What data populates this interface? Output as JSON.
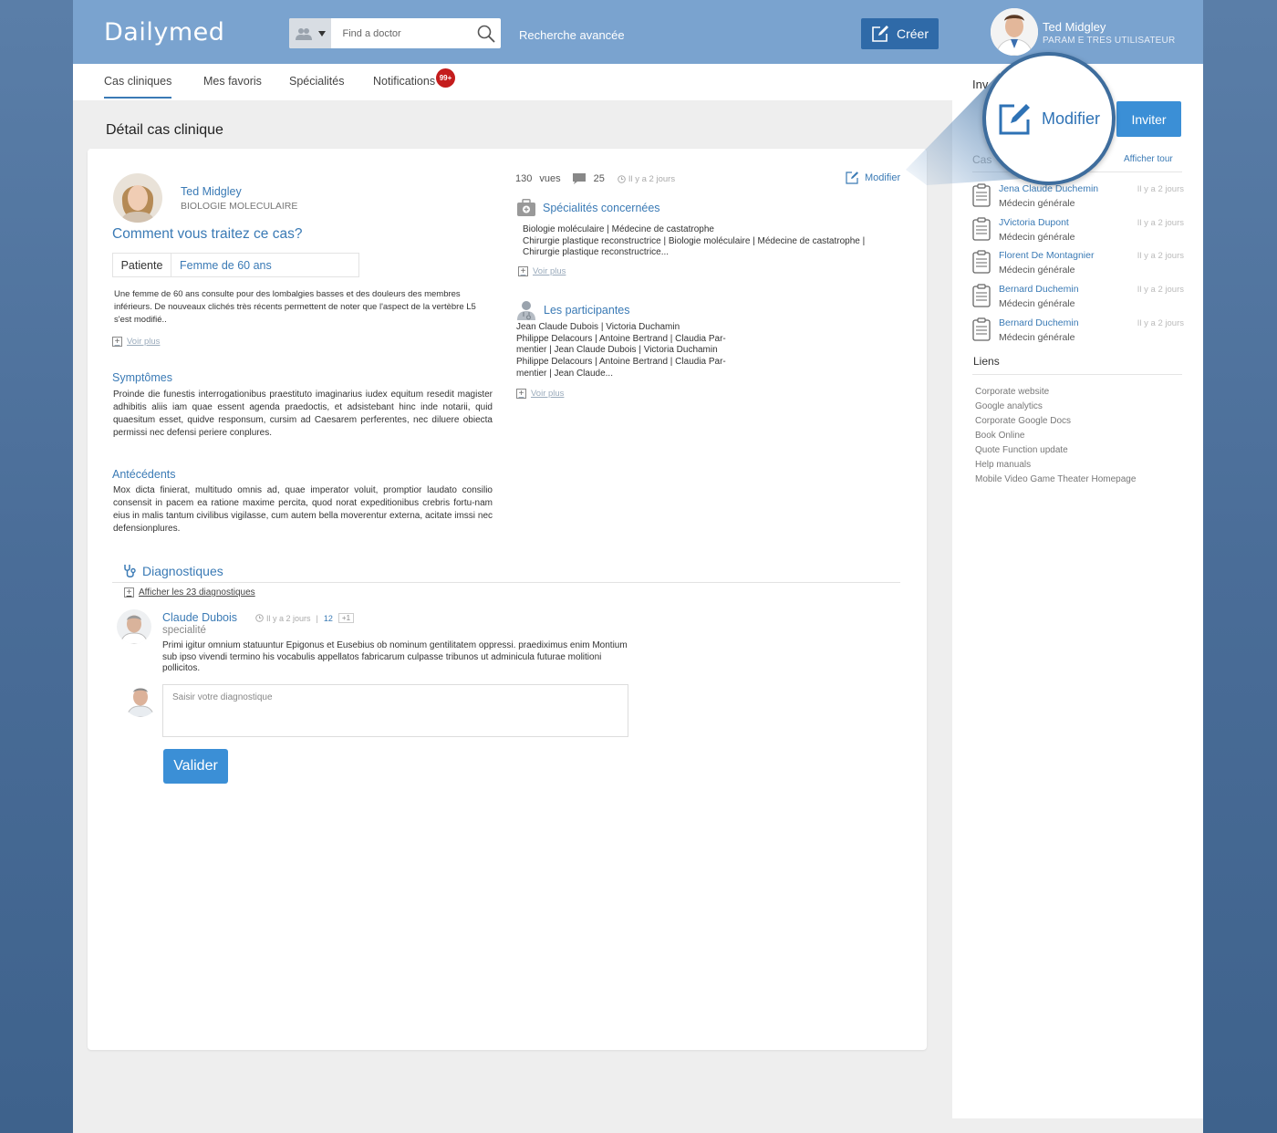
{
  "header": {
    "logo": "Dailymed",
    "search_placeholder": "Find a doctor",
    "advanced_search": "Recherche avancée",
    "create_label": "Créer",
    "user_name": "Ted Midgley",
    "user_params": "PARAM E TRES UTILISATEUR"
  },
  "nav": {
    "items": [
      "Cas cliniques",
      "Mes favoris",
      "Spécialités",
      "Notifications"
    ],
    "badge": "99+"
  },
  "page": {
    "title": "Détail cas clinique"
  },
  "case": {
    "author_name": "Ted Midgley",
    "author_specialty": "BIOLOGIE MOLECULAIRE",
    "question": "Comment vous traitez ce cas?",
    "patient_label": "Patiente",
    "patient_value": "Femme de 60 ans",
    "description": "Une femme de 60 ans consulte pour des lombalgies basses et des douleurs des membres inférieurs. De nouveaux clichés très récents permettent de noter que l'aspect de la vertèbre L5 s'est modifié..",
    "voir_plus": "Voir plus",
    "symptoms_title": "Symptômes",
    "symptoms_text": "Proinde die funestis interrogationibus praestituto imaginarius iudex equitum resedit magister adhibitis aliis iam quae essent agenda praedoctis, et adsistebant hinc inde notarii, quid quaesitum esset, quidve responsum, cursim ad Caesarem perferentes, nec diluere obiecta permissi nec defensi periere conplures.",
    "history_title": "Antécédents",
    "history_text": "Mox dicta finierat, multitudo omnis ad, quae imperator voluit, promptior laudato consilio consensit in pacem ea ratione maxime percita, quod norat expeditionibus crebris fortu-nam eius in malis tantum civilibus vigilasse, cum autem bella moverentur externa, acitate imssi nec defensionplures.",
    "views": "130",
    "views_label": "vues",
    "comments": "25",
    "time": "Il y a 2 jours",
    "edit_label": "Modifier",
    "specialties_title": "Spécialités concernées",
    "specialties_lines": [
      "Biologie moléculaire  |  Médecine de castatrophe",
      "Chirurgie plastique reconstructrice | Biologie moléculaire  |  Médecine de castatrophe |",
      "Chirurgie plastique reconstructrice..."
    ],
    "participants_title": "Les participantes",
    "participants_lines": [
      "Jean Claude Dubois |  Victoria Duchamin",
      "Philippe Delacours | Antoine Bertrand  |  Claudia Par-",
      "mentier | Jean Claude Dubois |  Victoria Duchamin",
      "Philippe Delacours | Antoine Bertrand  |  Claudia Par-",
      "mentier | Jean Claude..."
    ]
  },
  "diagnostics": {
    "title": "Diagnostiques",
    "show_all": "Afficher les 23 diagnostiques",
    "comment": {
      "name": "Claude Dubois",
      "time": "Il y a 2 jours",
      "count": "12",
      "plus": "+1",
      "specialty": "specialité",
      "text": "Primi igitur omnium statuuntur Epigonus et Eusebius ob nominum gentilitatem oppressi. praediximus enim Montium sub ipso vivendi termino his vocabulis appellatos fabricarum culpasse tribunos ut adminicula futurae molitioni pollicitos."
    },
    "input_placeholder": "Saisir votre diagnostique",
    "submit": "Valider"
  },
  "sidebar": {
    "inv_label": "Inv",
    "invite": "Inviter",
    "cases_label": "Cas",
    "show_all": "Afficher tour",
    "cases": [
      {
        "name": "Jena Claude Duchemin",
        "role": "Médecin générale",
        "time": "Il y a 2 jours"
      },
      {
        "name": "JVictoria Dupont",
        "role": "Médecin générale",
        "time": "Il y a 2 jours"
      },
      {
        "name": "Florent De Montagnier",
        "role": "Médecin générale",
        "time": "Il y a 2 jours"
      },
      {
        "name": "Bernard Duchemin",
        "role": "Médecin générale",
        "time": "Il y a 2 jours"
      },
      {
        "name": "Bernard Duchemin",
        "role": "Médecin générale",
        "time": "Il y a 2 jours"
      }
    ],
    "links_title": "Liens",
    "links": [
      "Corporate website",
      "Google analytics",
      "Corporate Google Docs",
      "Book Online",
      "Quote Function update",
      "Help manuals",
      "Mobile Video Game Theater Homepage"
    ]
  },
  "zoom": {
    "label": "Modifier"
  },
  "colors": {
    "header": "#7aa3cf",
    "accent": "#3a7ab5",
    "button": "#3b8fd6",
    "create": "#2f6aa8",
    "badge": "#c41c1c"
  }
}
